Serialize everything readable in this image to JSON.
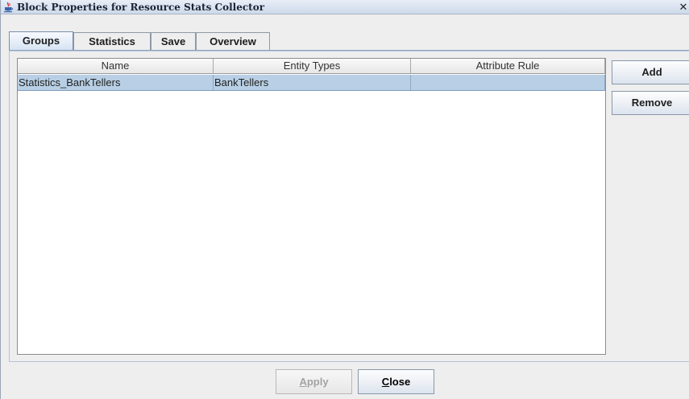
{
  "window": {
    "title": "Block Properties for Resource Stats Collector",
    "close_glyph": "✕",
    "icon": "java-cup-icon"
  },
  "tabs": [
    {
      "label": "Groups",
      "active": true
    },
    {
      "label": "Statistics",
      "active": false
    },
    {
      "label": "Save",
      "active": false
    },
    {
      "label": "Overview",
      "active": false
    }
  ],
  "table": {
    "columns": [
      "Name",
      "Entity Types",
      "Attribute Rule"
    ],
    "rows": [
      {
        "name": "Statistics_BankTellers",
        "entity_types": "BankTellers",
        "attribute_rule": "",
        "selected": true
      }
    ]
  },
  "side_buttons": {
    "add_label": "Add",
    "remove_label": "Remove"
  },
  "footer": {
    "apply_mnemonic": "A",
    "apply_rest": "pply",
    "apply_enabled": false,
    "close_mnemonic": "C",
    "close_rest": "lose"
  },
  "colors": {
    "selection": "#b8cfe5",
    "active_tab": "#d6e2f2"
  }
}
